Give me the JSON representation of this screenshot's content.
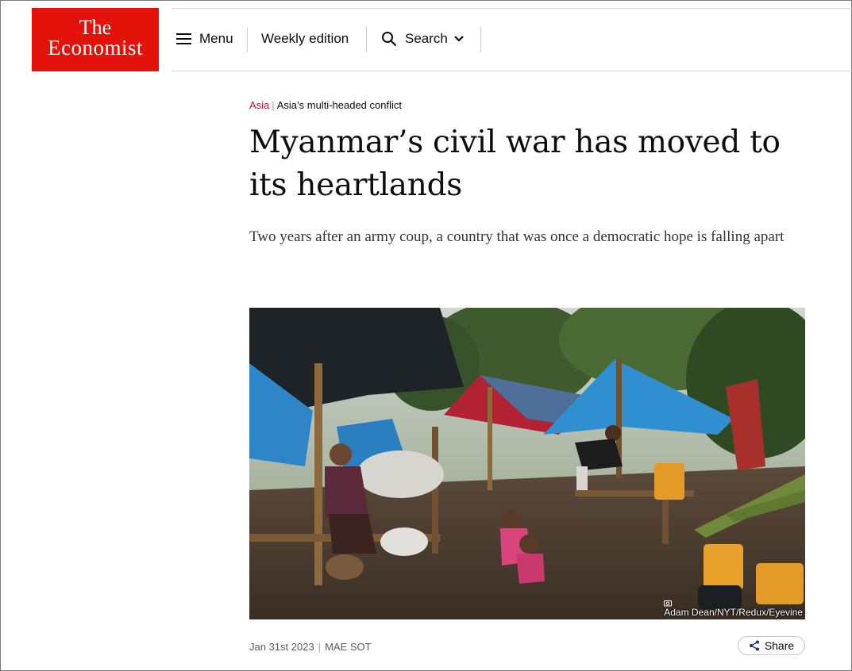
{
  "brand": {
    "logo_line1": "The",
    "logo_line2": "Economist",
    "color": "#e3120b"
  },
  "nav": {
    "menu_label": "Menu",
    "weekly_label": "Weekly edition",
    "search_label": "Search"
  },
  "article": {
    "section": "Asia",
    "subsection": "Asia’s multi-headed conflict",
    "headline": "Myanmar’s civil war has moved to its heartlands",
    "standfirst": "Two years after an army coup, a country that was once a democratic hope is falling apart",
    "image_credit": "Adam Dean/NYT/Redux/Eyevine",
    "date": "Jan 31st 2023",
    "location": "MAE SOT",
    "share_label": "Share"
  },
  "colors": {
    "section_red": "#c8102e",
    "tarp_blue": "#2f8fd1"
  }
}
